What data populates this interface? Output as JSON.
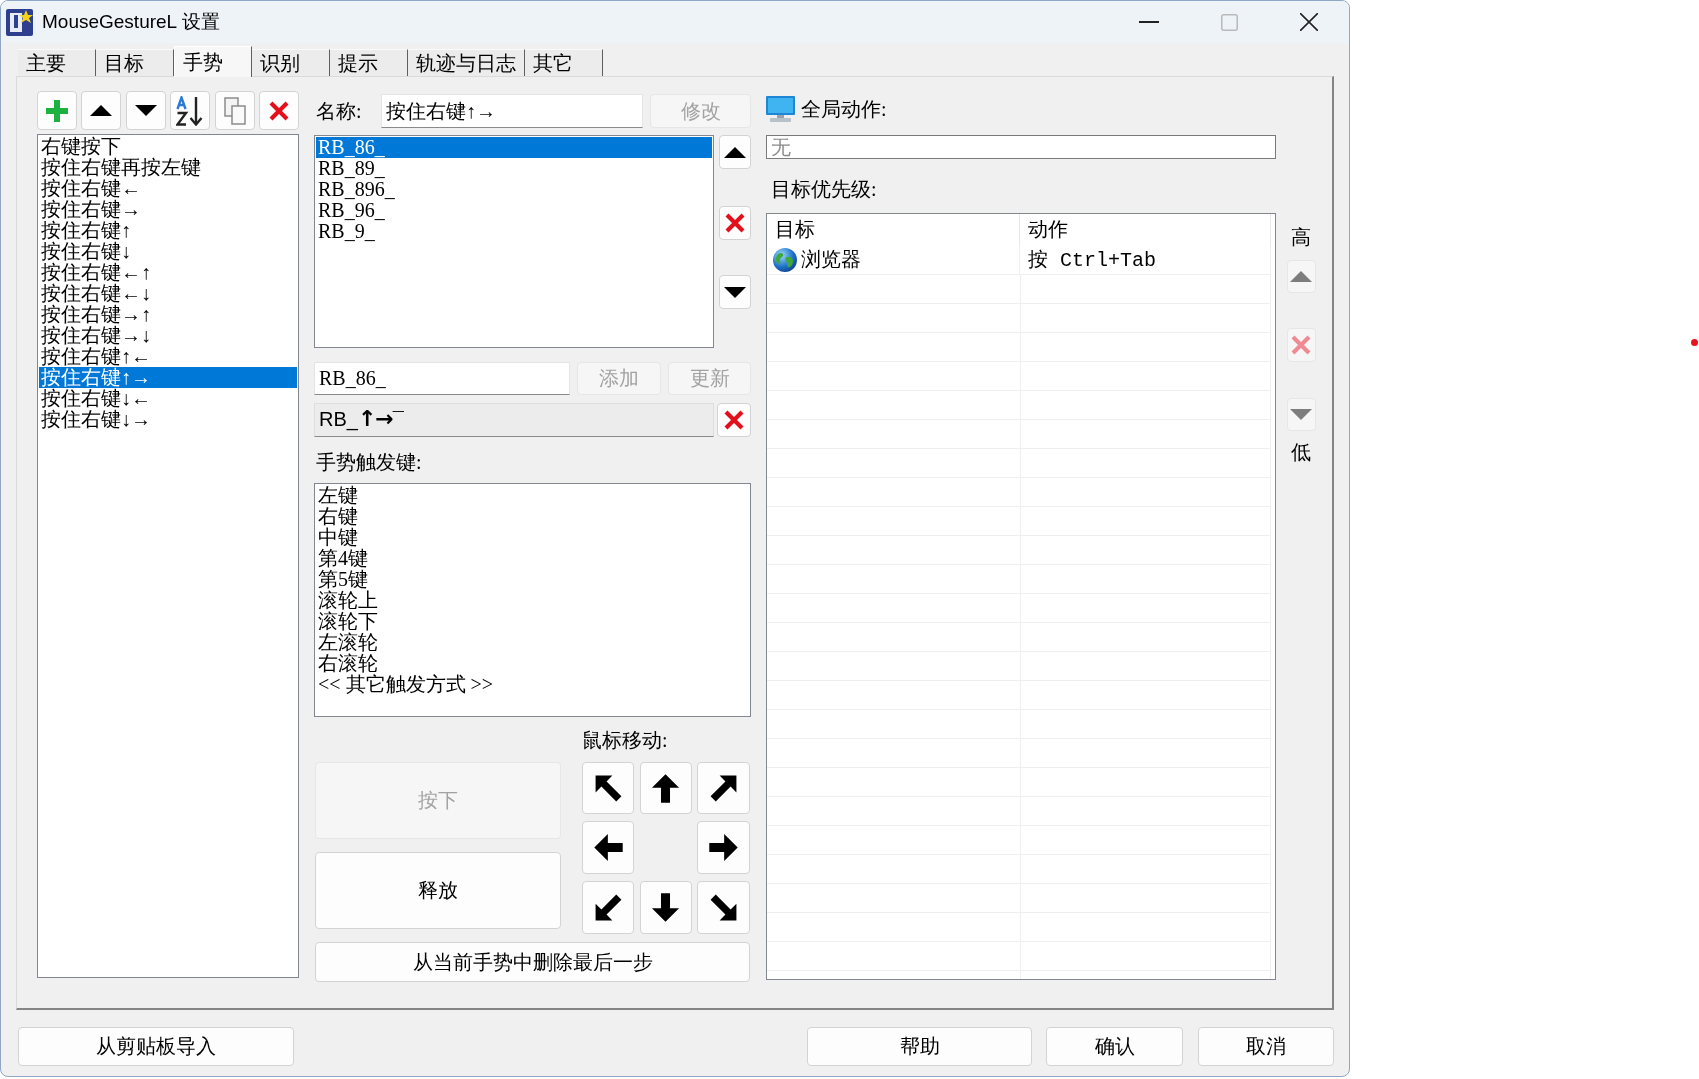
{
  "window": {
    "title": "MouseGestureL 设置",
    "controls": [
      {
        "kind": "minimize",
        "disabled": false
      },
      {
        "kind": "maximize",
        "disabled": true
      },
      {
        "kind": "close",
        "disabled": false
      }
    ]
  },
  "tabs": [
    {
      "label": "主要",
      "selected": false
    },
    {
      "label": "目标",
      "selected": false
    },
    {
      "label": "手势",
      "selected": true
    },
    {
      "label": "识别",
      "selected": false
    },
    {
      "label": "提示",
      "selected": false
    },
    {
      "label": "轨迹与日志",
      "selected": false
    },
    {
      "label": "其它",
      "selected": false
    }
  ],
  "gesture_toolbar": [
    {
      "kind": "add"
    },
    {
      "kind": "move_up"
    },
    {
      "kind": "move_down"
    },
    {
      "kind": "sort"
    },
    {
      "kind": "copy"
    },
    {
      "kind": "delete"
    }
  ],
  "gesture_list": [
    {
      "label": "右键按下",
      "selected": false
    },
    {
      "label": "按住右键再按左键",
      "selected": false
    },
    {
      "label": "按住右键←",
      "selected": false
    },
    {
      "label": "按住右键→",
      "selected": false
    },
    {
      "label": "按住右键↑",
      "selected": false
    },
    {
      "label": "按住右键↓",
      "selected": false
    },
    {
      "label": "按住右键←↑",
      "selected": false
    },
    {
      "label": "按住右键←↓",
      "selected": false
    },
    {
      "label": "按住右键→↑",
      "selected": false
    },
    {
      "label": "按住右键→↓",
      "selected": false
    },
    {
      "label": "按住右键↑←",
      "selected": false
    },
    {
      "label": "按住右键↑→",
      "selected": true
    },
    {
      "label": "按住右键↓←",
      "selected": false
    },
    {
      "label": "按住右键↓→",
      "selected": false
    }
  ],
  "name": {
    "label": "名称:",
    "value": "按住右键↑→"
  },
  "modify_button": {
    "label": "修改",
    "disabled": true
  },
  "pattern_list": [
    {
      "label": "RB_86_",
      "selected": true
    },
    {
      "label": "RB_89_",
      "selected": false
    },
    {
      "label": "RB_896_",
      "selected": false
    },
    {
      "label": "RB_96_",
      "selected": false
    },
    {
      "label": "RB_9_",
      "selected": false
    }
  ],
  "pattern_list_buttons": [
    {
      "kind": "move_up",
      "disabled": false
    },
    {
      "kind": "delete",
      "disabled": false
    },
    {
      "kind": "move_down",
      "disabled": false
    }
  ],
  "pattern_field": {
    "value": "RB_86_"
  },
  "add_button": {
    "label": "添加",
    "disabled": true
  },
  "update_button": {
    "label": "更新",
    "disabled": true
  },
  "gesture_preview": {
    "text": "RB_**↑→**¯"
  },
  "trigger_keys": {
    "label": "手势触发键:",
    "items": [
      {
        "label": "左键",
        "selected": false
      },
      {
        "label": "右键",
        "selected": false
      },
      {
        "label": "中键",
        "selected": false
      },
      {
        "label": "第4键",
        "selected": false
      },
      {
        "label": "第5键",
        "selected": false
      },
      {
        "label": "滚轮上",
        "selected": false
      },
      {
        "label": "滚轮下",
        "selected": false
      },
      {
        "label": "左滚轮",
        "selected": false
      },
      {
        "label": "右滚轮",
        "selected": false
      },
      {
        "label": "<< 其它触发方式 >>",
        "selected": false
      }
    ]
  },
  "mouse_move": {
    "label": "鼠标移动:",
    "press_button": {
      "label": "按下",
      "disabled": true
    },
    "release_button": {
      "label": "释放",
      "disabled": false
    },
    "directions": [
      {
        "kind": "up_left"
      },
      {
        "kind": "up"
      },
      {
        "kind": "up_right"
      },
      {
        "kind": "left"
      },
      {
        "kind": "right"
      },
      {
        "kind": "down_left"
      },
      {
        "kind": "down"
      },
      {
        "kind": "down_right"
      }
    ]
  },
  "delete_last_step_button": {
    "label": "从当前手势中删除最后一步"
  },
  "global_action": {
    "label": "全局动作:",
    "value": "无",
    "disabled": true
  },
  "target_priority": {
    "label": "目标优先级:",
    "columns": [
      "目标",
      "动作"
    ],
    "rows": [
      {
        "target": "浏览器",
        "action": "按 Ctrl+Tab"
      }
    ],
    "high_label": "高",
    "low_label": "低",
    "buttons": [
      {
        "kind": "move_up",
        "disabled": true
      },
      {
        "kind": "delete",
        "disabled": true
      },
      {
        "kind": "move_down",
        "disabled": true
      }
    ]
  },
  "footer": {
    "import_button": "从剪贴板导入",
    "help_button": "帮助",
    "ok_button": "确认",
    "cancel_button": "取消"
  }
}
